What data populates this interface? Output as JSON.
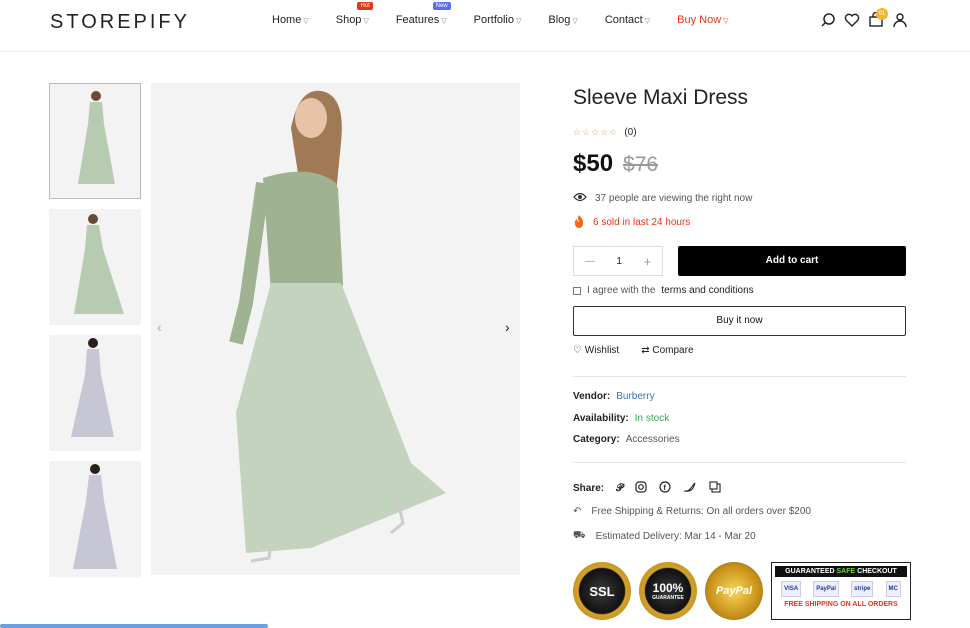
{
  "header": {
    "logo": "STOREPIFY",
    "nav": [
      {
        "label": "Home",
        "badge": ""
      },
      {
        "label": "Shop",
        "badge": "Hot"
      },
      {
        "label": "Features",
        "badge": "New"
      },
      {
        "label": "Portfolio",
        "badge": ""
      },
      {
        "label": "Blog",
        "badge": ""
      },
      {
        "label": "Contact",
        "badge": ""
      },
      {
        "label": "Buy Now",
        "badge": ""
      }
    ],
    "cart_count": "01",
    "icons": [
      "search-icon",
      "heart-icon",
      "cart-icon",
      "user-icon"
    ]
  },
  "gallery": {
    "thumbnails": [
      "dress-thumb-1",
      "dress-thumb-2",
      "dress-thumb-3",
      "dress-thumb-4"
    ],
    "prev_label": "‹",
    "next_label": "›"
  },
  "product": {
    "title": "Sleeve Maxi Dress",
    "stars": "☆☆☆☆☆",
    "review_count": "(0)",
    "price": "$50",
    "old_price": "$76",
    "viewing": "37 people are viewing the right now",
    "sold": "6 sold in last 24 hours",
    "quantity": "1",
    "qty_minus": "—",
    "qty_plus": "+",
    "add_to_cart": "Add to cart",
    "terms_prefix": "I agree with the",
    "terms_link": "terms and conditions",
    "buy_now": "Buy it now",
    "wishlist": "Wishlist",
    "compare": "Compare",
    "vendor_label": "Vendor:",
    "vendor": "Burberry",
    "availability_label": "Availability:",
    "availability": "In stock",
    "category_label": "Category:",
    "category": "Accessories",
    "share_label": "Share:",
    "shipping": "Free Shipping & Returns: On all orders over $200",
    "delivery": "Estimated Delivery: Mar 14 - Mar 20"
  },
  "trust": {
    "ssl": "SSL",
    "guarantee": "100%",
    "guarantee_sub": "GUARANTEE",
    "paypal": "PayPal",
    "checkout_title_1": "GUARANTEED",
    "checkout_title_2": "SAFE",
    "checkout_title_3": "CHECKOUT",
    "cards": [
      "VISA",
      "PayPal",
      "stripe",
      "MC"
    ],
    "free_shipping": "FREE SHIPPING ON ALL ORDERS"
  },
  "colors": {
    "accent_red": "#e5361a",
    "in_stock": "#34a853",
    "link": "#3b6fb6",
    "cart_badge": "#f2b531"
  }
}
